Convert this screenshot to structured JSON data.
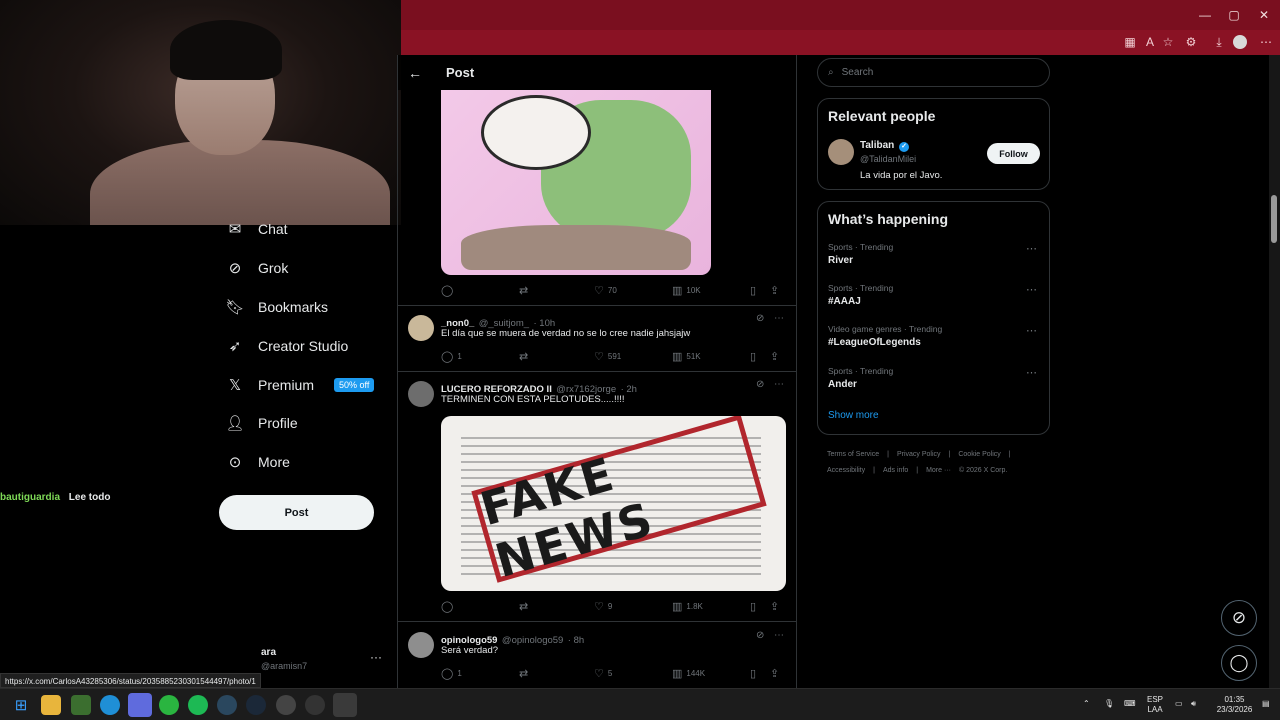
{
  "browser": {
    "window_controls": [
      "—",
      "▢",
      "✕"
    ],
    "toolbar_icons": [
      "app-icon",
      "read-aloud-icon",
      "favorite-icon",
      "extensions-icon",
      "downloads-icon",
      "profile-icon",
      "menu-icon"
    ]
  },
  "left_nav": {
    "items": [
      {
        "label": "Chat",
        "icon": "chat-icon"
      },
      {
        "label": "Grok",
        "icon": "grok-icon"
      },
      {
        "label": "Bookmarks",
        "icon": "bookmark-icon"
      },
      {
        "label": "Creator Studio",
        "icon": "rocket-icon"
      },
      {
        "label": "Premium",
        "icon": "x-logo-icon",
        "badge": "50% off"
      },
      {
        "label": "Profile",
        "icon": "person-icon"
      },
      {
        "label": "More",
        "icon": "more-circle-icon"
      }
    ],
    "post_button": "Post",
    "account": {
      "name": "ara",
      "handle": "@aramisn7",
      "more": "···"
    }
  },
  "stream_chat": {
    "user": "bautiguardia",
    "message": "Lee todo"
  },
  "status_bar": {
    "url": "https://x.com/CarlosA43285306/status/2035885230301544497/photo/1"
  },
  "header": {
    "title": "Post"
  },
  "first_post_actions": {
    "replies": "",
    "reposts": "",
    "likes": "70",
    "views": "10K"
  },
  "tweets": [
    {
      "name": "_non0_",
      "handle": "@_suitjom_",
      "time": "· 10h",
      "text": "El día que se muera de verdad no se lo cree nadie jahsjajw",
      "replies": "1",
      "reposts": "",
      "likes": "591",
      "views": "51K"
    },
    {
      "name": "LUCERO REFORZADO II",
      "handle": "@rx7162jorge",
      "time": "· 2h",
      "text": "TERMINEN CON ESTA PELOTUDES.....!!!!",
      "image_text": "FAKE NEWS",
      "replies": "",
      "reposts": "",
      "likes": "9",
      "views": "1.8K"
    },
    {
      "name": "opinologo59",
      "handle": "@opinologo59",
      "time": "· 8h",
      "text": "Será verdad?",
      "replies": "1",
      "reposts": "",
      "likes": "5",
      "views": "144K"
    }
  ],
  "right": {
    "search_placeholder": "Search",
    "relevant_title": "Relevant people",
    "person": {
      "name": "Taliban",
      "handle": "@TalidanMilei",
      "bio": "La vida por el Javo.",
      "follow": "Follow"
    },
    "happening_title": "What’s happening",
    "trends": [
      {
        "meta": "Sports · Trending",
        "name": "River"
      },
      {
        "meta": "Sports · Trending",
        "name": "#AAAJ"
      },
      {
        "meta": "Video game genres · Trending",
        "name": "#LeagueOfLegends"
      },
      {
        "meta": "Sports · Trending",
        "name": "Ander"
      }
    ],
    "show_more": "Show more",
    "footer": [
      "Terms of Service",
      "|",
      "Privacy Policy",
      "|",
      "Cookie Policy",
      "|",
      "Accessibility",
      "|",
      "Ads info",
      "|",
      "More ···",
      "© 2026 X Corp."
    ]
  },
  "taskbar": {
    "lang_top": "ESP",
    "lang_bottom": "LAA",
    "time": "01:35",
    "date": "23/3/2026"
  },
  "colors": {
    "accent": "#1d9bf0",
    "chrome": "#7a0f1f",
    "border": "#2f3336",
    "muted": "#71767b"
  }
}
